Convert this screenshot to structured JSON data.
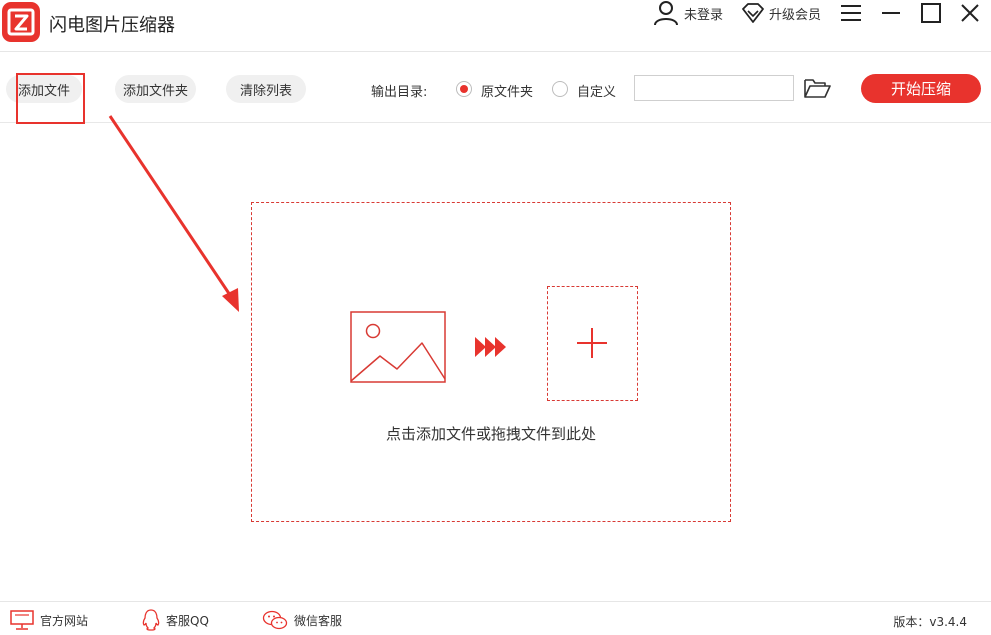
{
  "app": {
    "title": "闪电图片压缩器"
  },
  "header": {
    "login_label": "未登录",
    "vip_label": "升级会员"
  },
  "toolbar": {
    "add_file": "添加文件",
    "add_folder": "添加文件夹",
    "clear_list": "清除列表",
    "output_label": "输出目录:",
    "option_original": "原文件夹",
    "option_custom": "自定义",
    "selected_option": "原文件夹",
    "output_path": "",
    "start_button": "开始压缩"
  },
  "dropzone": {
    "hint": "点击添加文件或拖拽文件到此处"
  },
  "footer": {
    "website": "官方网站",
    "qq": "客服QQ",
    "wechat": "微信客服",
    "version": "版本：v3.4.4"
  },
  "icons": {
    "app_logo": "lightning-logo-icon",
    "user": "user-icon",
    "vip": "diamond-icon",
    "menu": "menu-icon",
    "minimize": "minimize-icon",
    "maximize": "maximize-icon",
    "close": "close-icon",
    "folder": "folder-open-icon",
    "image": "image-icon",
    "arrows": "triple-arrow-icon",
    "add": "plus-icon",
    "monitor": "monitor-icon",
    "qq": "qq-icon",
    "wechat": "wechat-icon"
  },
  "colors": {
    "accent": "#e8332d",
    "border": "#d83a34"
  }
}
